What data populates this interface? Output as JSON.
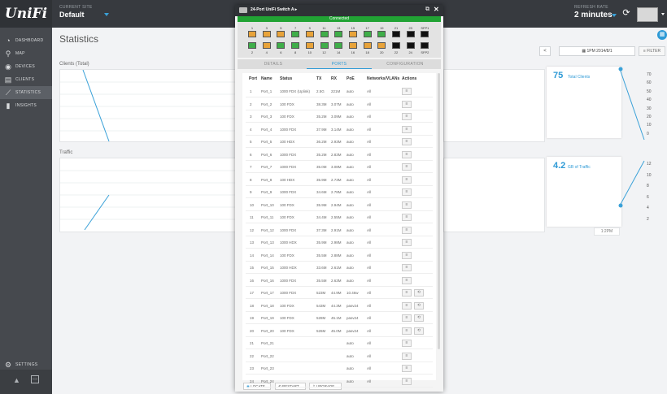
{
  "brand": "UniFi",
  "header": {
    "site_label": "CURRENT SITE",
    "site_name": "Default",
    "refresh_label": "REFRESH RATE",
    "refresh_value": "2 minutes"
  },
  "sidebar": {
    "items": [
      {
        "label": "DASHBOARD",
        "icon": "dashboard-icon",
        "glyph": "◔"
      },
      {
        "label": "MAP",
        "icon": "map-pin-icon",
        "glyph": "⚲"
      },
      {
        "label": "DEVICES",
        "icon": "devices-icon",
        "glyph": "◉"
      },
      {
        "label": "CLIENTS",
        "icon": "clients-icon",
        "glyph": "▤"
      },
      {
        "label": "STATISTICS",
        "icon": "statistics-icon",
        "glyph": "⟋"
      },
      {
        "label": "INSIGHTS",
        "icon": "insights-icon",
        "glyph": "▮"
      }
    ],
    "settings_label": "SETTINGS"
  },
  "main": {
    "title": "Statistics",
    "clients_chart_label": "Clients (Total)",
    "traffic_chart_label": "Traffic",
    "date_range": "1PM 2014/8/1",
    "filter_label": "FILTER",
    "clients_stat": {
      "value": "75",
      "caption": "Total Clients",
      "ticks": [
        "70",
        "60",
        "50",
        "40",
        "30",
        "20",
        "10",
        "0"
      ]
    },
    "traffic_stat": {
      "value": "4.2",
      "caption": "GB of Traffic",
      "ticks": [
        "12",
        "10",
        "8",
        "6",
        "4",
        "2"
      ]
    },
    "time_label": "1:2PM"
  },
  "modal": {
    "title": "24-Port UniFi Switch A ▸",
    "status": "Connected",
    "top_port_numbers": [
      "1",
      "3",
      "5",
      "7",
      "9",
      "11",
      "13",
      "15",
      "17",
      "19",
      "21",
      "23",
      "SFP1"
    ],
    "bottom_port_numbers": [
      "2",
      "4",
      "6",
      "8",
      "10",
      "12",
      "14",
      "16",
      "18",
      "20",
      "22",
      "24",
      "SFP2"
    ],
    "top_port_colors": [
      "#e8a33a",
      "#e8a33a",
      "#e8a33a",
      "#3fae49",
      "#e8a33a",
      "#3fae49",
      "#3fae49",
      "#e8a33a",
      "#3fae49",
      "#3fae49",
      "#111111",
      "#111111",
      "#111111"
    ],
    "bottom_port_colors": [
      "#3fae49",
      "#e8a33a",
      "#3fae49",
      "#3fae49",
      "#e8a33a",
      "#3fae49",
      "#3fae49",
      "#e8a33a",
      "#e8a33a",
      "#e8a33a",
      "#111111",
      "#111111",
      "#111111"
    ],
    "tabs": [
      "DETAILS",
      "PORTS",
      "CONFIGURATION"
    ],
    "active_tab": "PORTS",
    "table": {
      "headers": [
        "Port",
        "Name",
        "Status",
        "TX",
        "RX",
        "PoE",
        "Networks/VLANs",
        "Actions"
      ],
      "rows": [
        {
          "port": "1",
          "name": "Port_1",
          "status": "1000 FDX (Uplink)",
          "tx": "2.5G",
          "rx": "221M",
          "poe": "auto",
          "net": "All",
          "cycle": false
        },
        {
          "port": "2",
          "name": "Port_2",
          "status": "100 FDX",
          "tx": "38.3M",
          "rx": "3.07M",
          "poe": "auto",
          "net": "All",
          "cycle": false
        },
        {
          "port": "3",
          "name": "Port_3",
          "status": "100 FDX",
          "tx": "35.2M",
          "rx": "3.09M",
          "poe": "auto",
          "net": "All",
          "cycle": false
        },
        {
          "port": "4",
          "name": "Port_4",
          "status": "1000 FDX",
          "tx": "37.9M",
          "rx": "3.14M",
          "poe": "auto",
          "net": "All",
          "cycle": false
        },
        {
          "port": "5",
          "name": "Port_5",
          "status": "100 HDX",
          "tx": "36.2M",
          "rx": "2.93M",
          "poe": "auto",
          "net": "All",
          "cycle": false
        },
        {
          "port": "6",
          "name": "Port_6",
          "status": "1000 FDX",
          "tx": "35.2M",
          "rx": "2.83M",
          "poe": "auto",
          "net": "All",
          "cycle": false
        },
        {
          "port": "7",
          "name": "Port_7",
          "status": "1000 FDX",
          "tx": "35.0M",
          "rx": "3.08M",
          "poe": "auto",
          "net": "All",
          "cycle": false
        },
        {
          "port": "8",
          "name": "Port_8",
          "status": "100 HDX",
          "tx": "35.9M",
          "rx": "2.73M",
          "poe": "auto",
          "net": "All",
          "cycle": false
        },
        {
          "port": "9",
          "name": "Port_9",
          "status": "1000 FDX",
          "tx": "34.6M",
          "rx": "2.78M",
          "poe": "auto",
          "net": "All",
          "cycle": false
        },
        {
          "port": "10",
          "name": "Port_10",
          "status": "100 FDX",
          "tx": "35.9M",
          "rx": "2.94M",
          "poe": "auto",
          "net": "All",
          "cycle": false
        },
        {
          "port": "11",
          "name": "Port_11",
          "status": "100 FDX",
          "tx": "34.4M",
          "rx": "2.55M",
          "poe": "auto",
          "net": "All",
          "cycle": false
        },
        {
          "port": "12",
          "name": "Port_12",
          "status": "1000 FDX",
          "tx": "37.3M",
          "rx": "2.91M",
          "poe": "auto",
          "net": "All",
          "cycle": false
        },
        {
          "port": "13",
          "name": "Port_13",
          "status": "1000 HDX",
          "tx": "35.9M",
          "rx": "2.98M",
          "poe": "auto",
          "net": "All",
          "cycle": false
        },
        {
          "port": "14",
          "name": "Port_14",
          "status": "100 FDX",
          "tx": "35.5M",
          "rx": "2.88M",
          "poe": "auto",
          "net": "All",
          "cycle": false
        },
        {
          "port": "15",
          "name": "Port_15",
          "status": "1000 HDX",
          "tx": "33.6M",
          "rx": "2.61M",
          "poe": "auto",
          "net": "All",
          "cycle": false
        },
        {
          "port": "16",
          "name": "Port_16",
          "status": "1000 FDX",
          "tx": "35.5M",
          "rx": "2.63M",
          "poe": "auto",
          "net": "All",
          "cycle": false
        },
        {
          "port": "17",
          "name": "Port_17",
          "status": "1000 FDX",
          "tx": "523M",
          "rx": "44.9M",
          "poe": "10.46w",
          "net": "All",
          "cycle": true
        },
        {
          "port": "18",
          "name": "Port_18",
          "status": "100 FDX",
          "tx": "543M",
          "rx": "44.3M",
          "poe": "pasv24",
          "net": "All",
          "cycle": true
        },
        {
          "port": "19",
          "name": "Port_19",
          "status": "100 FDX",
          "tx": "528M",
          "rx": "45.1M",
          "poe": "pasv24",
          "net": "All",
          "cycle": true
        },
        {
          "port": "20",
          "name": "Port_20",
          "status": "100 FDX",
          "tx": "526M",
          "rx": "45.0M",
          "poe": "pasv24",
          "net": "All",
          "cycle": true
        },
        {
          "port": "21",
          "name": "Port_21",
          "status": "",
          "tx": "",
          "rx": "",
          "poe": "auto",
          "net": "All",
          "cycle": false
        },
        {
          "port": "22",
          "name": "Port_22",
          "status": "",
          "tx": "",
          "rx": "",
          "poe": "auto",
          "net": "All",
          "cycle": false
        },
        {
          "port": "23",
          "name": "Port_23",
          "status": "",
          "tx": "",
          "rx": "",
          "poe": "auto",
          "net": "All",
          "cycle": false
        },
        {
          "port": "24",
          "name": "Port_24",
          "status": "",
          "tx": "",
          "rx": "",
          "poe": "auto",
          "net": "All",
          "cycle": false
        }
      ]
    },
    "footer": {
      "locate": "LOCATE",
      "restart": "RESTART",
      "upgrade": "UPGRADE"
    }
  }
}
